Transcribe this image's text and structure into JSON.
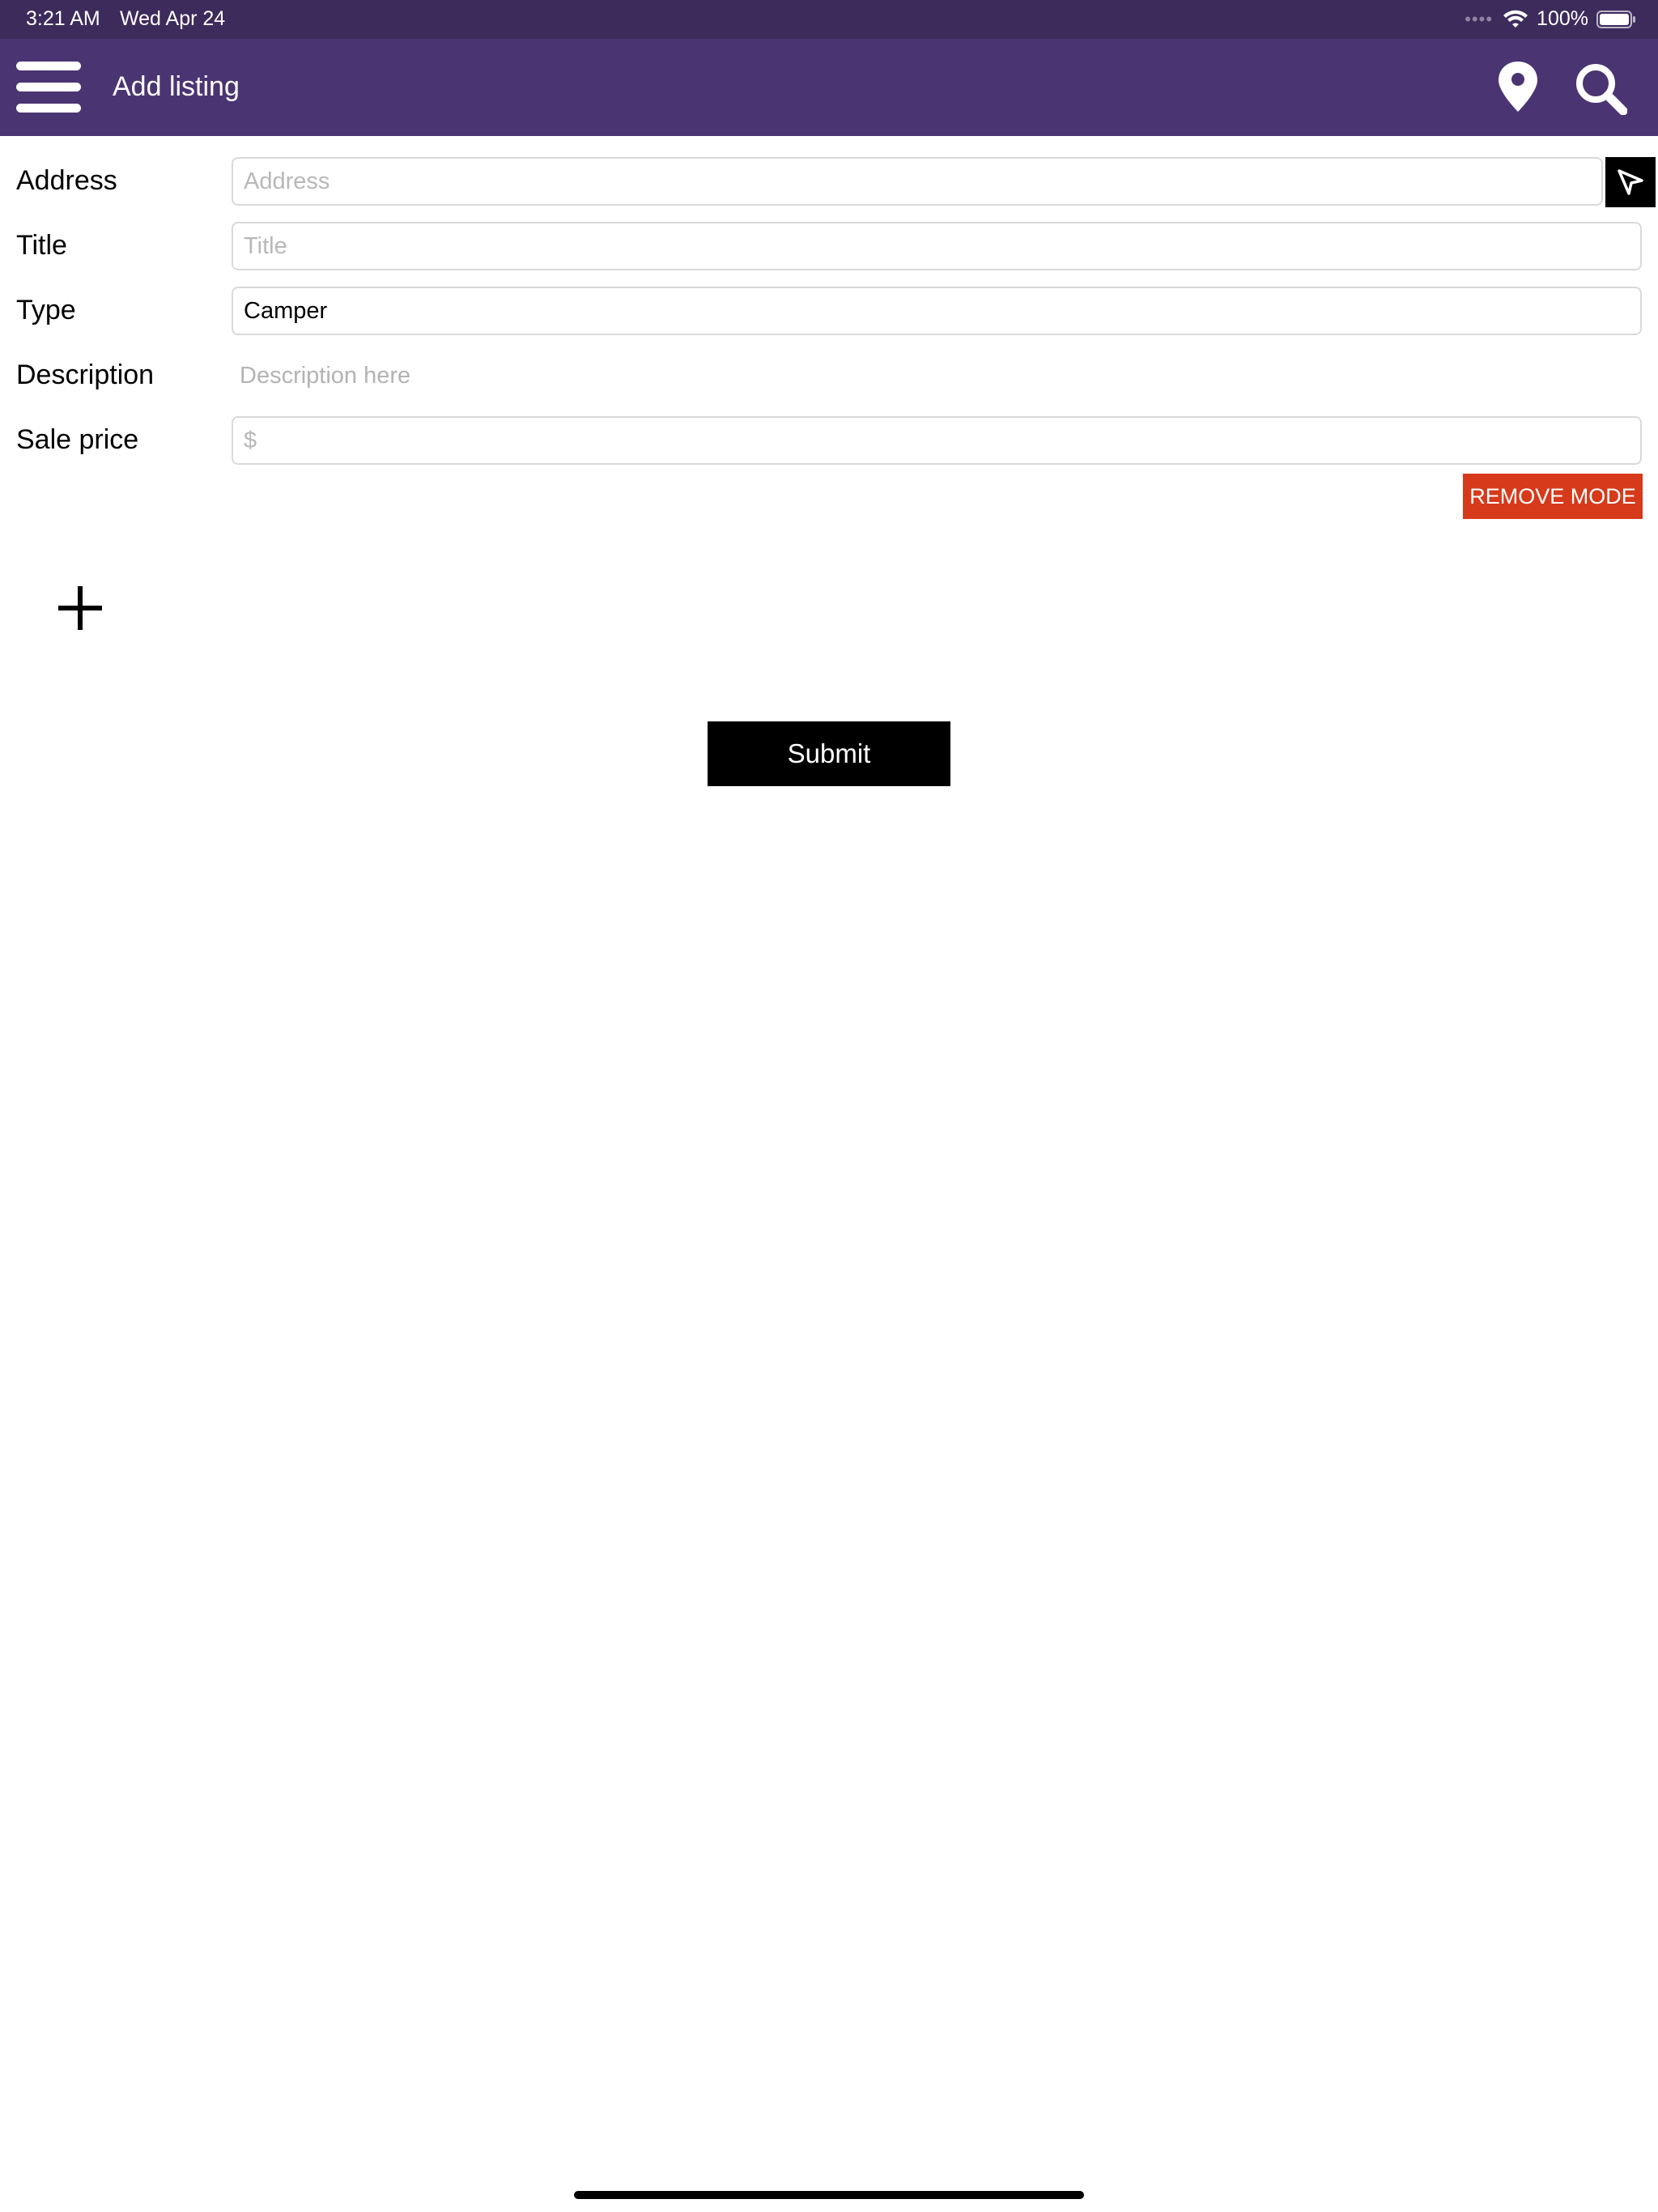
{
  "status_bar": {
    "time": "3:21 AM",
    "date": "Wed Apr 24",
    "signal_dots": "••••",
    "battery_percent": "100%"
  },
  "app_bar": {
    "title": "Add listing",
    "background_color": "#4a3472",
    "icons": [
      "menu-icon",
      "map-pin-icon",
      "search-icon"
    ]
  },
  "form": {
    "address": {
      "label": "Address",
      "value": "",
      "placeholder": "Address"
    },
    "title": {
      "label": "Title",
      "value": "",
      "placeholder": "Title"
    },
    "type": {
      "label": "Type",
      "value": "Camper"
    },
    "description": {
      "label": "Description",
      "placeholder": "Description here"
    },
    "sale_price": {
      "label": "Sale price",
      "value": "",
      "placeholder": "$"
    }
  },
  "buttons": {
    "remove_mode": "REMOVE MODE",
    "remove_mode_color": "#d63a1a",
    "submit": "Submit"
  }
}
